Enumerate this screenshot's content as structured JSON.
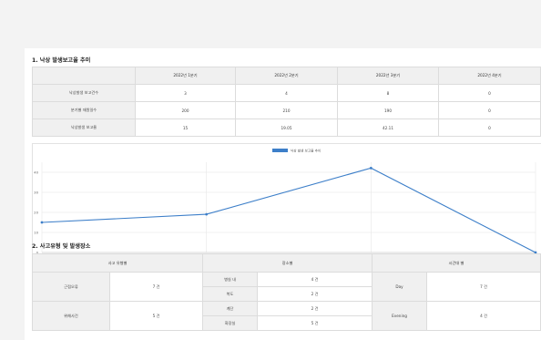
{
  "section1": {
    "title": "1. 낙상 발생보고율 추이",
    "columns": [
      "",
      "2022년 1분기",
      "2022년 2분기",
      "2022년 3분기",
      "2022년 4분기"
    ],
    "rows": [
      {
        "label": "낙상발생 보고건수",
        "values": [
          "3",
          "4",
          "8",
          "0"
        ]
      },
      {
        "label": "분기별 재원일수",
        "values": [
          "200",
          "210",
          "190",
          "0"
        ]
      },
      {
        "label": "낙상발생 보고율",
        "values": [
          "15",
          "19.05",
          "42.11",
          "0"
        ]
      }
    ]
  },
  "chart_data": {
    "type": "line",
    "title": "",
    "categories": [
      "1분기",
      "2분기",
      "3분기",
      "4분기"
    ],
    "series": [
      {
        "name": "낙상 발생 보고율 추이",
        "values": [
          15,
          19.05,
          42.11,
          0
        ],
        "color": "#3d7fc9"
      }
    ],
    "yticks": [
      "0",
      "10",
      "20",
      "30",
      "40"
    ],
    "ylim": [
      0,
      45
    ],
    "grid": true,
    "legend": "top-center"
  },
  "section2": {
    "title": "2. 사고유형 및 발생장소",
    "headers": {
      "type": "사고 유형별",
      "place": "장소별",
      "time": "시간대 별"
    },
    "types": [
      {
        "label": "근접오류",
        "count": "7 건"
      },
      {
        "label": "위해사건",
        "count": "5 건"
      }
    ],
    "places": [
      {
        "label": "병실 내",
        "count": "4 건"
      },
      {
        "label": "복도",
        "count": "2 건"
      },
      {
        "label": "계단",
        "count": "2 건"
      },
      {
        "label": "화장실",
        "count": "5 건"
      }
    ],
    "times": [
      {
        "label": "Day",
        "count": "7 건"
      },
      {
        "label": "Evening",
        "count": "4 건"
      }
    ]
  }
}
